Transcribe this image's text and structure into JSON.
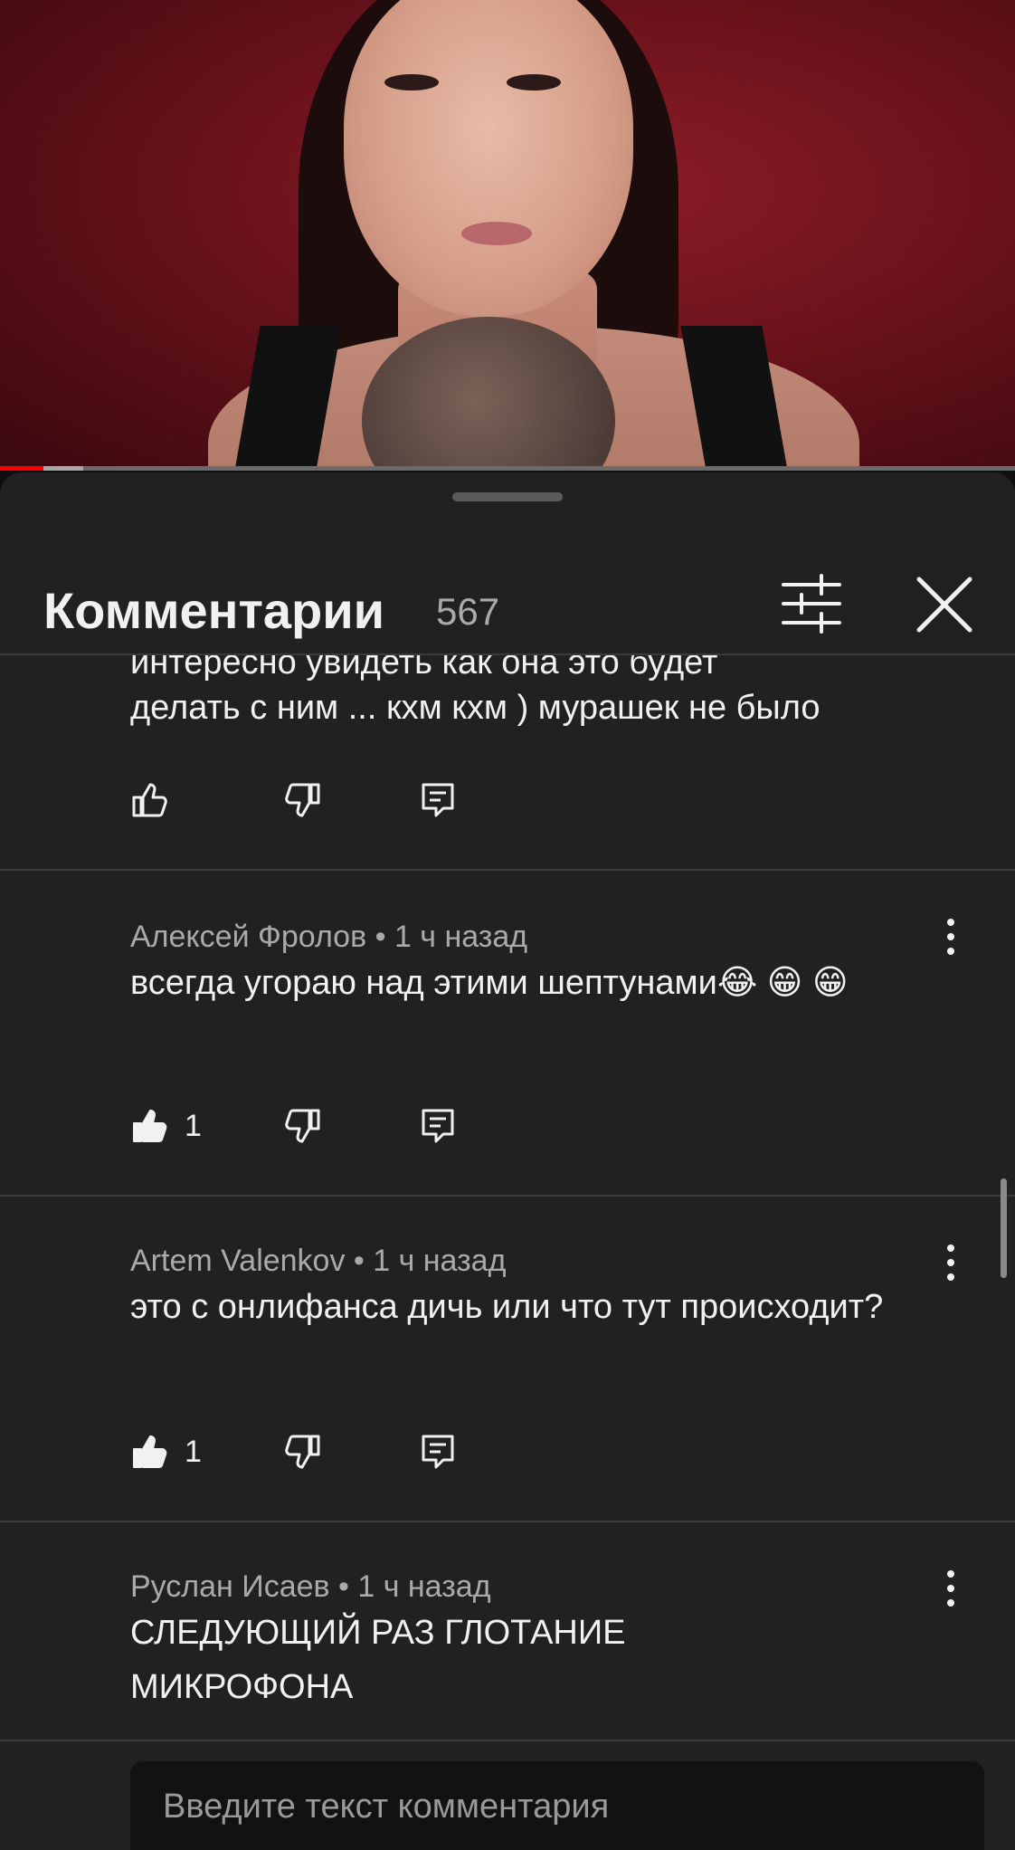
{
  "video": {
    "progress_played_fraction": 0.043,
    "progress_buffered_fraction": 0.082,
    "colors": {
      "played": "#ff0000",
      "buffer": "#a8a8a8",
      "track": "#6b6b6b"
    }
  },
  "sheet": {
    "title": "Комментарии",
    "count": "567",
    "filter_icon": "sort-filter-icon",
    "close_icon": "close-icon"
  },
  "comments": [
    {
      "author": "",
      "time": "",
      "meta": "",
      "text_partial_top": "интересно увидеть как она это будет",
      "text": "делать с ним ... кхм кхм ) мурашек не было",
      "likes": ""
    },
    {
      "author": "Алексей Фролов",
      "time": "1 ч назад",
      "meta": "Алексей Фролов • 1 ч назад",
      "text": "всегда угораю над этими шептунами😂 😁 😁",
      "likes": "1"
    },
    {
      "author": "Artem Valenkov",
      "time": "1 ч назад",
      "meta": "Artem Valenkov • 1 ч назад",
      "text": "это с онлифанса дичь или что тут происходит?",
      "likes": "1"
    },
    {
      "author": "Руслан Исаев",
      "time": "1 ч назад",
      "meta": "Руслан Исаев • 1 ч назад",
      "text": "СЛЕДУЮЩИЙ РАЗ ГЛОТАНИЕ МИКРОФОНА",
      "likes": ""
    }
  ],
  "input": {
    "placeholder": "Введите текст комментария",
    "value": ""
  },
  "icons": [
    "thumb-up-icon",
    "thumb-down-icon",
    "reply-icon",
    "more-vertical-icon"
  ]
}
